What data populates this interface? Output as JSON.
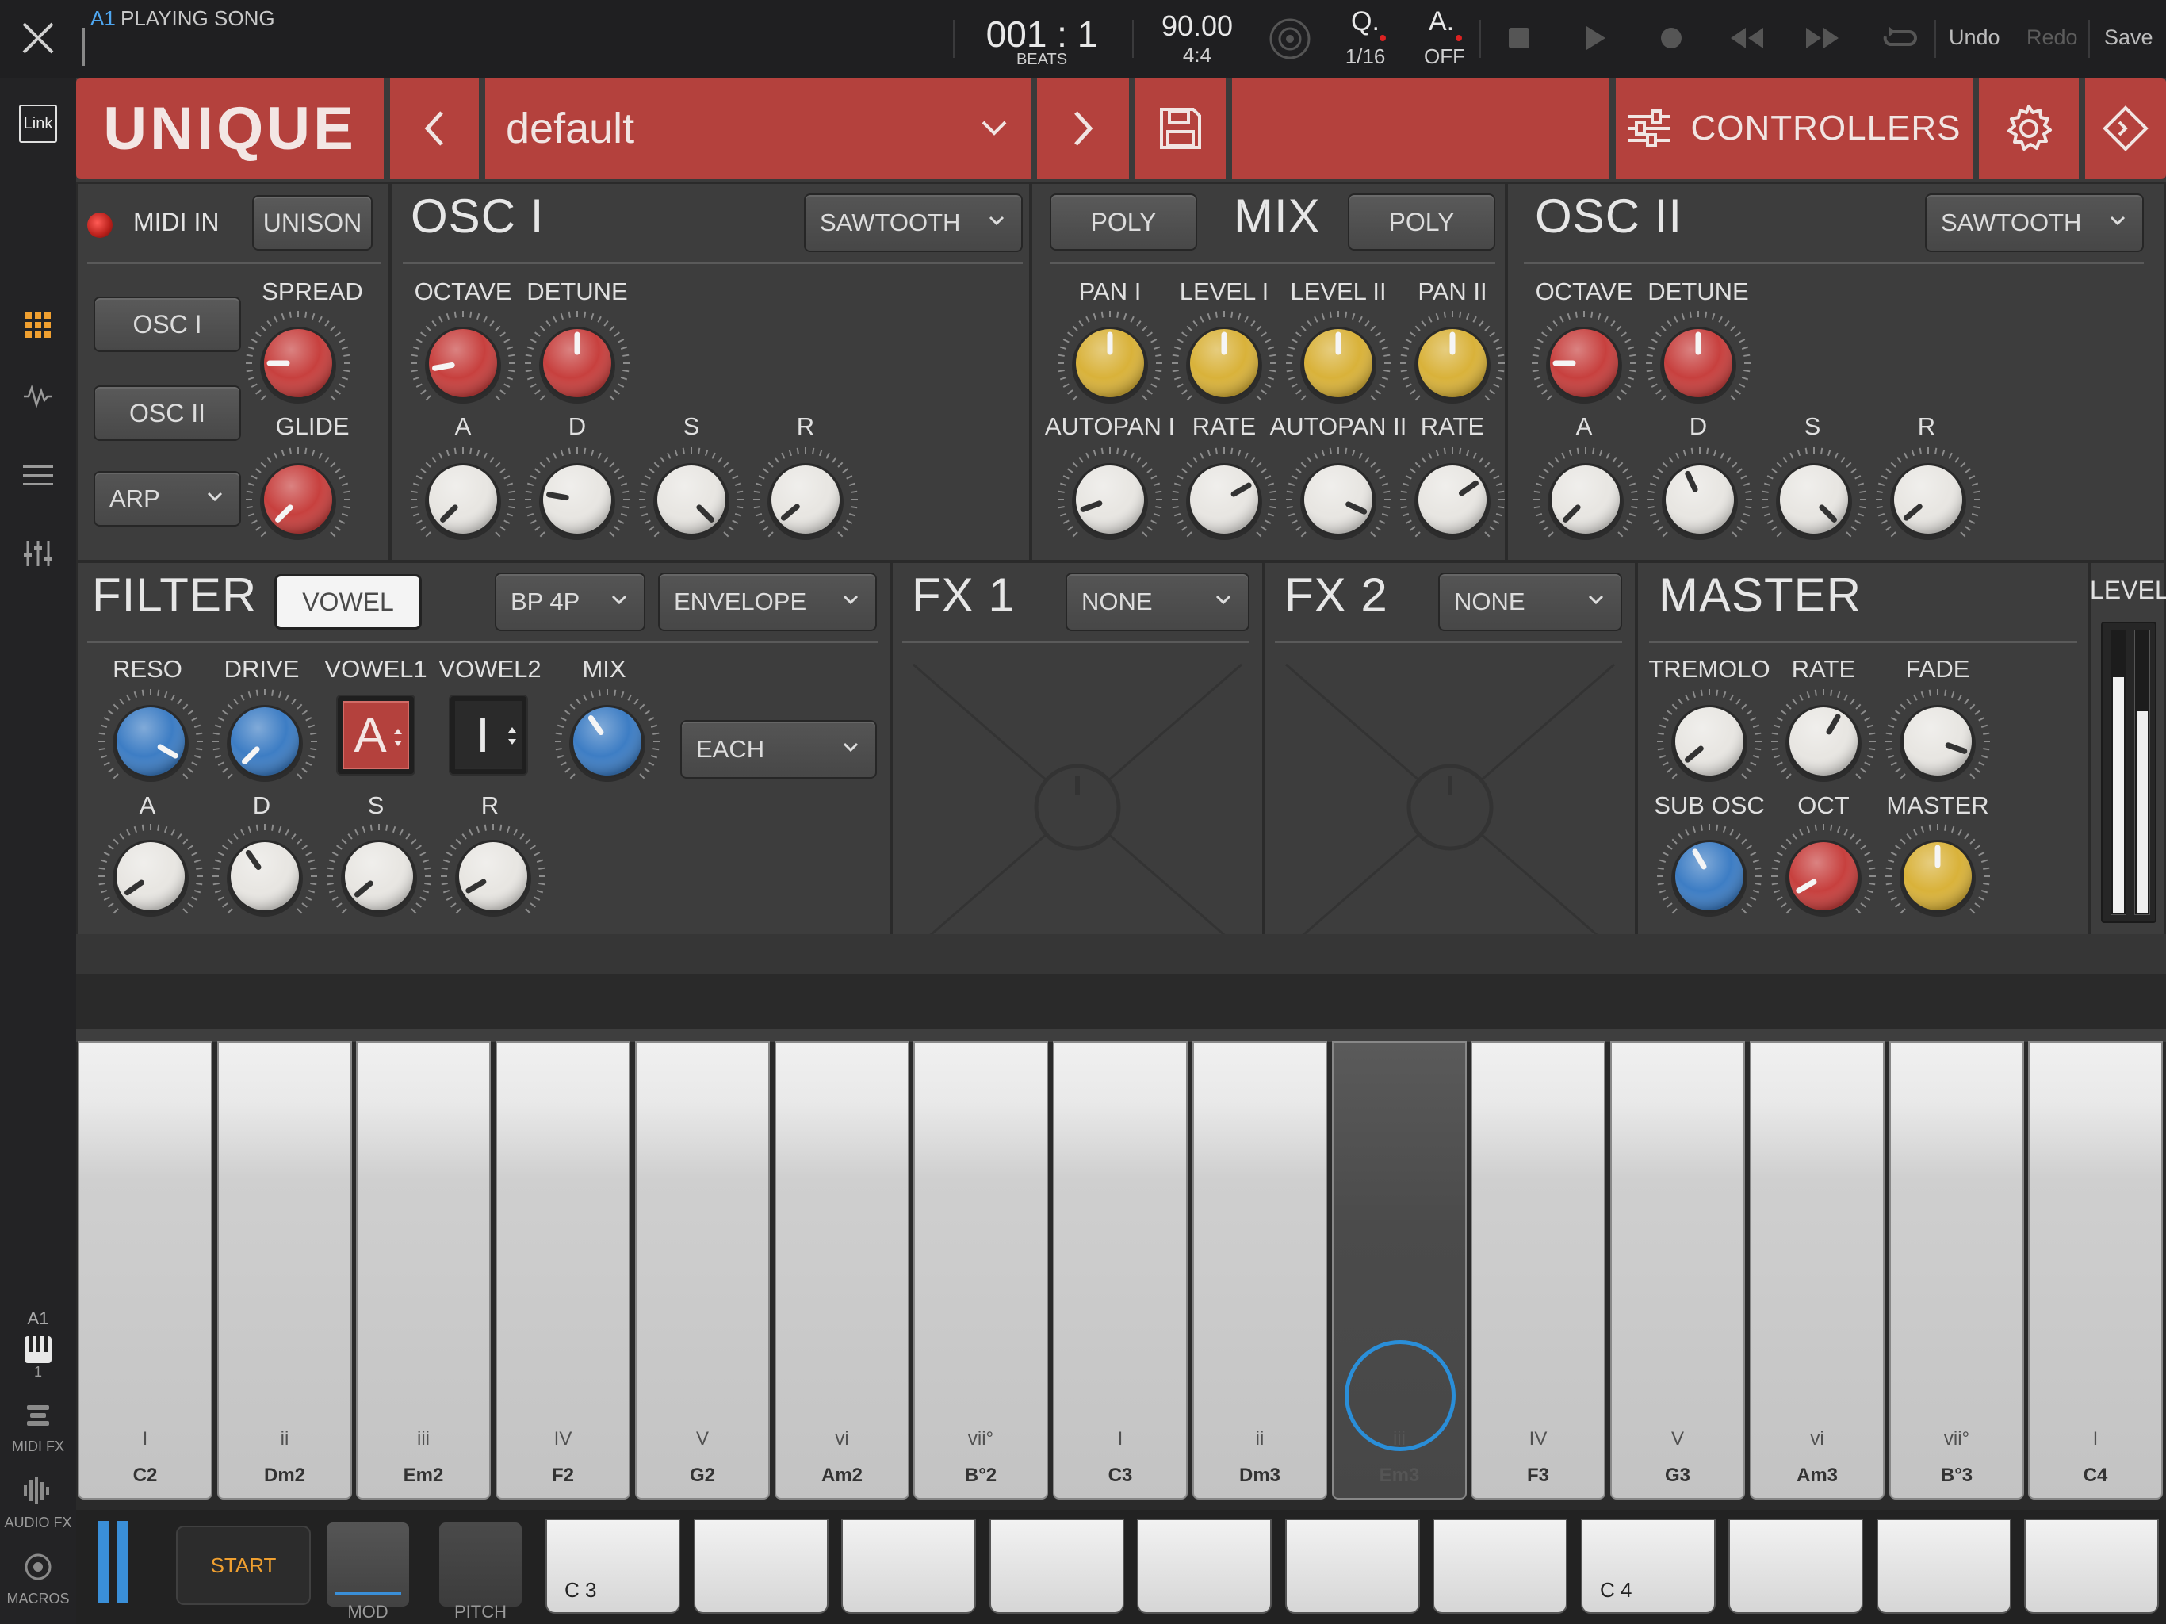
{
  "topbar": {
    "track": "A1",
    "status": "PLAYING SONG",
    "position": "001 : 1",
    "position_unit": "BEATS",
    "tempo": "90.00",
    "meter": "4:4",
    "quantize_label": "Q.",
    "quantize_value": "1/16",
    "auto_label": "A.",
    "auto_value": "OFF",
    "undo": "Undo",
    "redo": "Redo",
    "save": "Save"
  },
  "leftbar": {
    "link": "Link",
    "track": "A1",
    "track_num": "1",
    "midi_fx": "MIDI FX",
    "audio_fx": "AUDIO FX",
    "macros": "MACROS"
  },
  "header": {
    "logo": "UNIQUE",
    "preset": "default",
    "controllers": "CONTROLLERS"
  },
  "voice": {
    "midi_in": "MIDI IN",
    "unison": "UNISON",
    "osc1": "OSC I",
    "osc2": "OSC II",
    "arp": "ARP",
    "spread": "SPREAD",
    "glide": "GLIDE"
  },
  "osc1": {
    "title": "OSC I",
    "wave": "SAWTOOTH",
    "octave": "OCTAVE",
    "detune": "DETUNE",
    "a": "A",
    "d": "D",
    "s": "S",
    "r": "R"
  },
  "mix": {
    "title": "MIX",
    "poly1": "POLY",
    "poly2": "POLY",
    "pan1": "PAN I",
    "level1": "LEVEL I",
    "level2": "LEVEL II",
    "pan2": "PAN II",
    "autopan1": "AUTOPAN I",
    "rate1": "RATE",
    "autopan2": "AUTOPAN II",
    "rate2": "RATE"
  },
  "osc2": {
    "title": "OSC II",
    "wave": "SAWTOOTH",
    "octave": "OCTAVE",
    "detune": "DETUNE",
    "a": "A",
    "d": "D",
    "s": "S",
    "r": "R"
  },
  "filter": {
    "title": "FILTER",
    "vowel": "VOWEL",
    "type": "BP 4P",
    "mode": "ENVELOPE",
    "reso": "RESO",
    "drive": "DRIVE",
    "vowel1": "VOWEL1",
    "vowel2": "VOWEL2",
    "mix": "MIX",
    "vowel1_value": "A",
    "vowel2_value": "I",
    "each": "EACH",
    "a": "A",
    "d": "D",
    "s": "S",
    "r": "R"
  },
  "fx1": {
    "title": "FX 1",
    "value": "NONE"
  },
  "fx2": {
    "title": "FX 2",
    "value": "NONE"
  },
  "master": {
    "title": "MASTER",
    "tremolo": "TREMOLO",
    "rate": "RATE",
    "fade": "FADE",
    "sub_osc": "SUB OSC",
    "oct": "OCT",
    "master": "MASTER"
  },
  "level": {
    "title": "LEVEL",
    "left": 0.83,
    "right": 0.71
  },
  "keys": [
    {
      "roman": "I",
      "note": "C2"
    },
    {
      "roman": "ii",
      "note": "Dm2"
    },
    {
      "roman": "iii",
      "note": "Em2"
    },
    {
      "roman": "IV",
      "note": "F2"
    },
    {
      "roman": "V",
      "note": "G2"
    },
    {
      "roman": "vi",
      "note": "Am2"
    },
    {
      "roman": "vii°",
      "note": "B°2"
    },
    {
      "roman": "I",
      "note": "C3"
    },
    {
      "roman": "ii",
      "note": "Dm3"
    },
    {
      "roman": "iii",
      "note": "Em3"
    },
    {
      "roman": "IV",
      "note": "F3"
    },
    {
      "roman": "V",
      "note": "G3"
    },
    {
      "roman": "vi",
      "note": "Am3"
    },
    {
      "roman": "vii°",
      "note": "B°3"
    },
    {
      "roman": "I",
      "note": "C4"
    }
  ],
  "mini": {
    "start": "START",
    "mod": "MOD",
    "pitch": "PITCH",
    "c3": "C 3",
    "c4": "C 4"
  },
  "colors": {
    "accent": "#b4413d",
    "knob_red": "#c7403e",
    "knob_yellow": "#d9b23a",
    "knob_blue": "#3d7dc4",
    "knob_white": "#e8e6e2",
    "link_blue": "#4ea6f0"
  }
}
